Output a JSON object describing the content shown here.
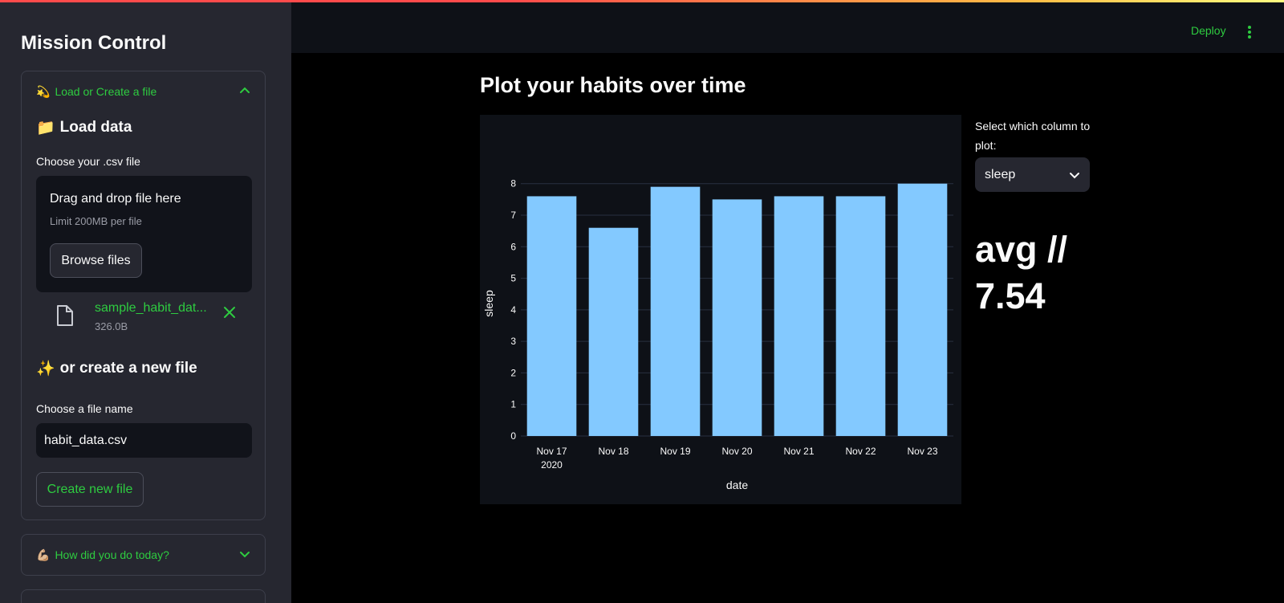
{
  "sidebar": {
    "title": "Mission Control",
    "expander_load": {
      "label": "Load or Create a file",
      "emoji": "💫",
      "load_heading": "Load data",
      "load_emoji": "📁",
      "csv_label": "Choose your .csv file",
      "dropzone_title": "Drag and drop file here",
      "dropzone_limit": "Limit 200MB per file",
      "browse_label": "Browse files",
      "uploaded_file": {
        "name": "sample_habit_dat...",
        "size": "326.0B"
      },
      "create_heading": "or create a new file",
      "create_emoji": "✨",
      "filename_label": "Choose a file name",
      "filename_value": "habit_data.csv",
      "create_button": "Create new file"
    },
    "expander_today": {
      "label": "How did you do today?",
      "emoji": "💪🏼"
    }
  },
  "header": {
    "deploy_label": "Deploy"
  },
  "main": {
    "title": "Plot your habits over time",
    "select_label": "Select which column to plot:",
    "select_value": "sleep",
    "avg_text_line1": "avg //",
    "avg_text_line2": "7.54"
  },
  "colors": {
    "accent": "#2ecc40",
    "bar": "#83c9ff",
    "bg": "#000000",
    "sidebar": "#262730",
    "chart_bg": "#0e1117"
  },
  "chart_data": {
    "type": "bar",
    "categories": [
      "Nov 17",
      "Nov 18",
      "Nov 19",
      "Nov 20",
      "Nov 21",
      "Nov 22",
      "Nov 23"
    ],
    "category_sublabels": [
      "2020",
      "",
      "",
      "",
      "",
      "",
      ""
    ],
    "values": [
      7.6,
      6.6,
      7.9,
      7.5,
      7.6,
      7.6,
      8.0
    ],
    "xlabel": "date",
    "ylabel": "sleep",
    "yticks": [
      0,
      1,
      2,
      3,
      4,
      5,
      6,
      7,
      8
    ],
    "ylim": [
      0,
      8.4
    ],
    "grid": true
  }
}
